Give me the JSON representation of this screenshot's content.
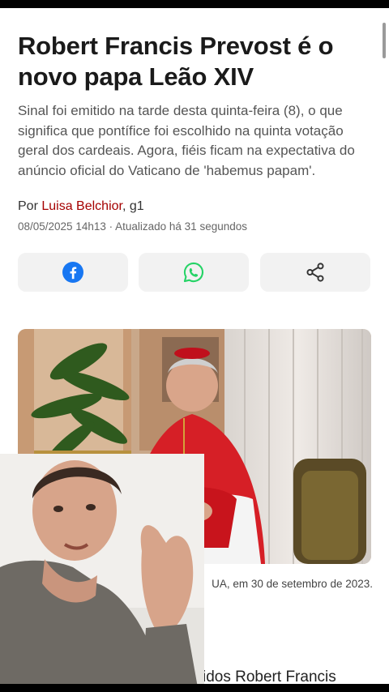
{
  "article": {
    "title": "Robert Francis Prevost é o novo papa Leão XIV",
    "subtitle": "Sinal foi emitido na tarde desta quinta-feira (8), o que significa que pontífice foi escolhido na quinta votação geral dos cardeais. Agora, fiéis ficam na expectativa do anúncio oficial do Vaticano de 'habemus papam'.",
    "byline_prefix": "Por ",
    "author": "Luisa Belchior",
    "byline_suffix": ", g1",
    "date": "08/05/2025 14h13 · Atualizado há 31 segundos",
    "caption": "UA, em 30 de setembro de 2023.",
    "next_text": "idos Robert Francis"
  },
  "share": {
    "facebook_icon": "facebook-icon",
    "whatsapp_icon": "whatsapp-icon",
    "share_icon": "share-icon"
  },
  "colors": {
    "author_link": "#a50000",
    "facebook": "#1877f2",
    "whatsapp": "#25d366",
    "button_bg": "#f2f2f2"
  }
}
